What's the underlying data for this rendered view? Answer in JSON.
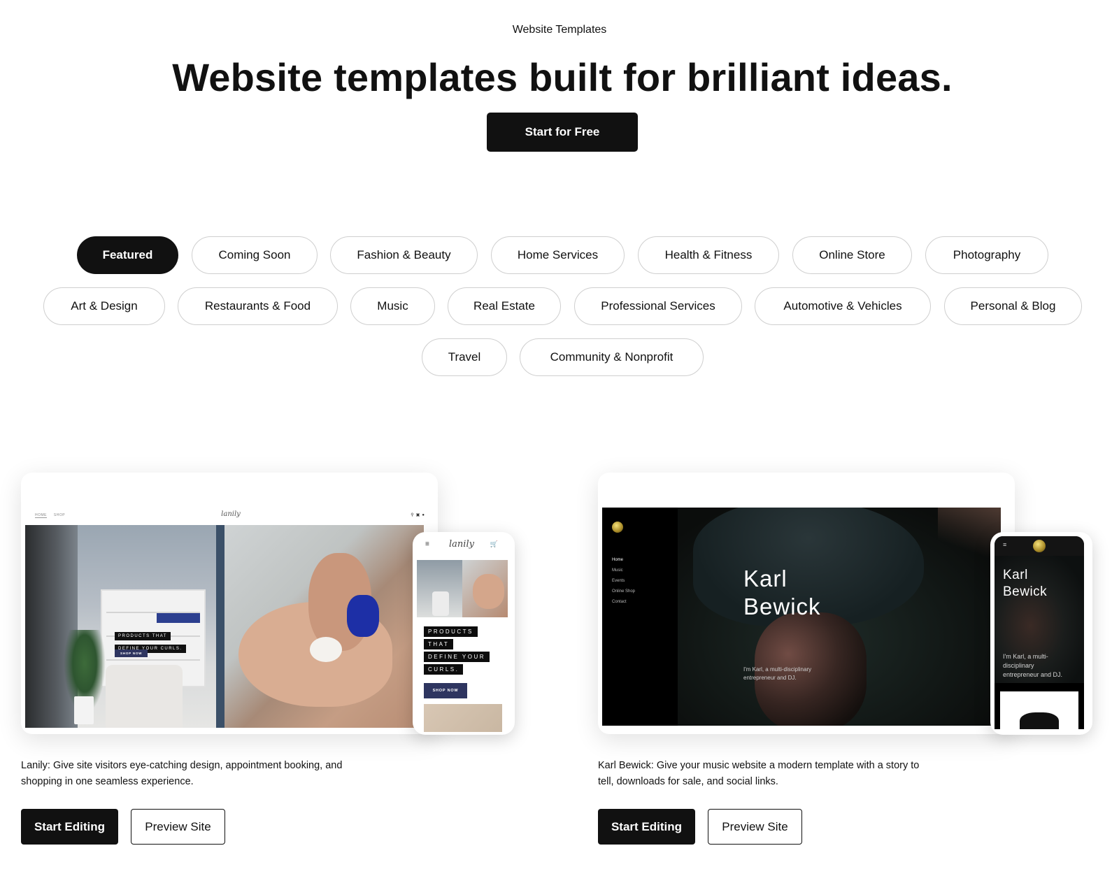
{
  "header": {
    "eyebrow": "Website Templates",
    "title": "Website templates built for brilliant ideas.",
    "cta_label": "Start for Free"
  },
  "categories": {
    "active": "Featured",
    "items": [
      "Featured",
      "Coming Soon",
      "Fashion & Beauty",
      "Home Services",
      "Health & Fitness",
      "Online Store",
      "Photography",
      "Art & Design",
      "Restaurants & Food",
      "Music",
      "Real Estate",
      "Professional Services",
      "Automotive & Vehicles",
      "Personal & Blog",
      "Travel",
      "Community & Nonprofit"
    ]
  },
  "templates": [
    {
      "name": "Lanily",
      "description": "Give site visitors eye-catching design, appointment booking, and shopping in one seamless experience.",
      "start_label": "Start Editing",
      "preview_label": "Preview Site",
      "desktop_preview": {
        "nav_links": [
          "HOME",
          "SHOP"
        ],
        "logo": "lanily",
        "nav_icons": [
          "search-icon",
          "cart-icon",
          "user-icon"
        ],
        "headline_lines": [
          "PRODUCTS THAT",
          "DEFINE YOUR CURLS."
        ],
        "button": "SHOP NOW"
      },
      "mobile_preview": {
        "logo": "lanily",
        "headline_lines": [
          "PRODUCTS",
          "THAT",
          "DEFINE YOUR",
          "CURLS."
        ],
        "button": "SHOP NOW"
      }
    },
    {
      "name": "Karl Bewick",
      "description": "Give your music website a modern template with a story to tell, downloads for sale, and social links.",
      "start_label": "Start Editing",
      "preview_label": "Preview Site",
      "desktop_preview": {
        "nav_links": [
          "Home",
          "Music",
          "Events",
          "Online Shop",
          "Contact"
        ],
        "name_lines": [
          "Karl",
          "Bewick"
        ],
        "bio_lines": [
          "I'm Karl, a multi-disciplinary",
          "entrepreneur and DJ."
        ]
      },
      "mobile_preview": {
        "name_lines": [
          "Karl",
          "Bewick"
        ],
        "bio_lines": [
          "I'm Karl, a multi-",
          "disciplinary",
          "entrepreneur and DJ."
        ]
      }
    }
  ],
  "colors": {
    "primary": "#111111",
    "background": "#ffffff",
    "chip_border": "#cfcfcf",
    "lanily_accent": "#2e3560",
    "karl_gold": "#c9a93a"
  }
}
